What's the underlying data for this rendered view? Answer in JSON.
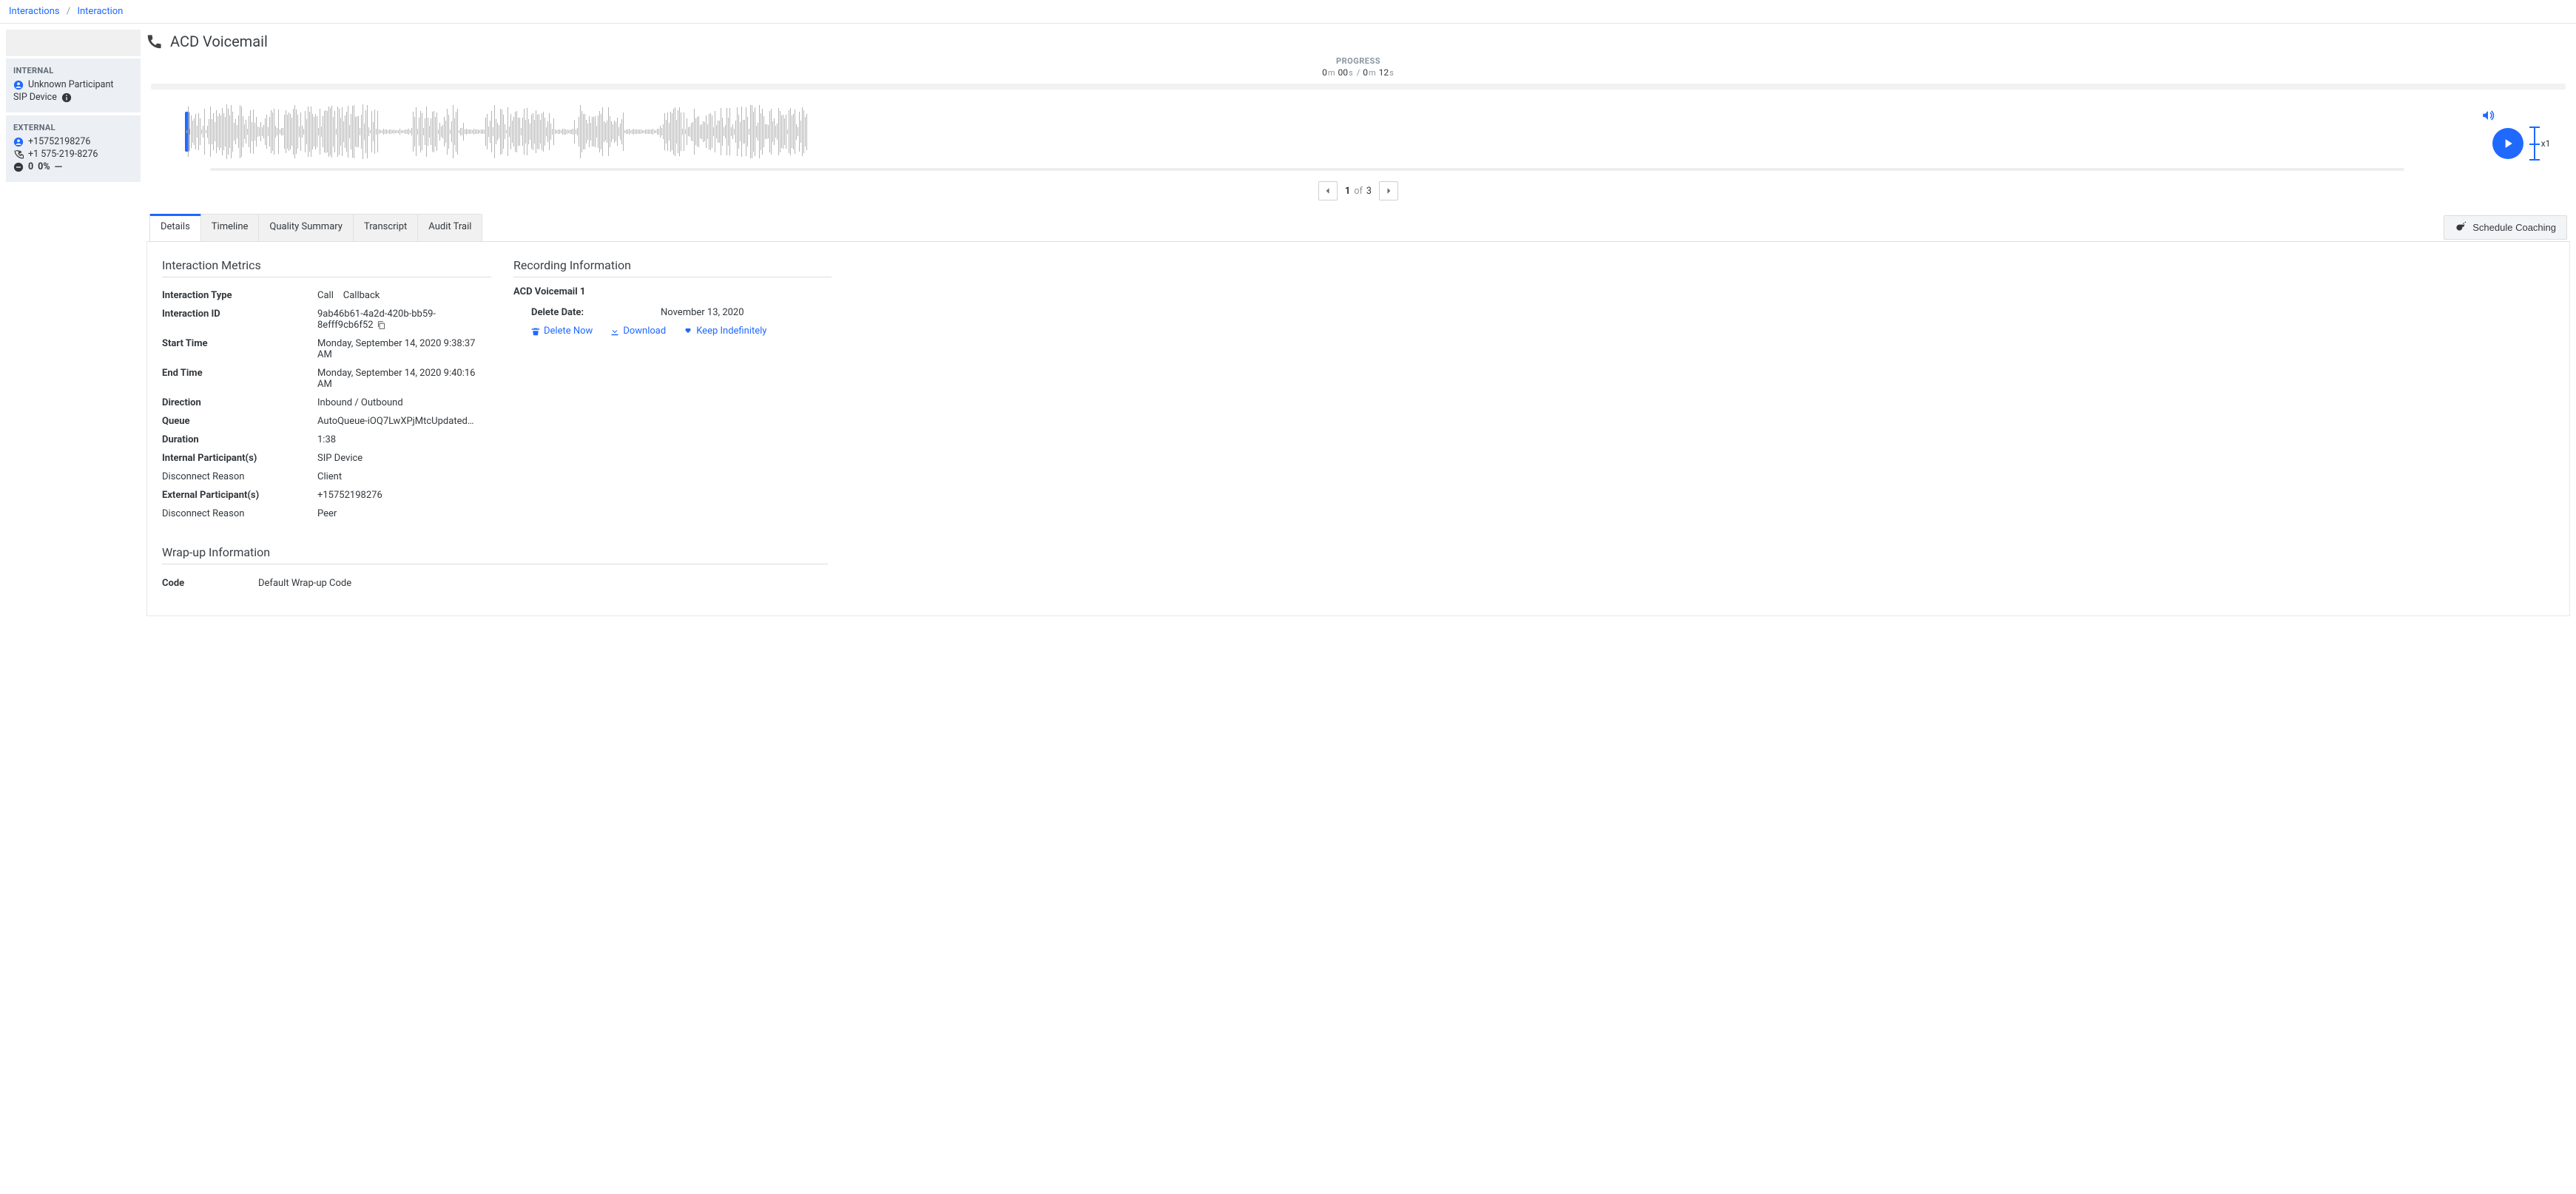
{
  "breadcrumb": {
    "root": "Interactions",
    "current": "Interaction"
  },
  "title": "ACD Voicemail",
  "participants": {
    "internal": {
      "heading": "INTERNAL",
      "name": "Unknown Participant",
      "device": "SIP Device"
    },
    "external": {
      "heading": "EXTERNAL",
      "raw_number": "+15752198276",
      "formatted_number": "+1 575-219-8276",
      "sentiment_count": "0",
      "sentiment_pct": "0%"
    }
  },
  "player": {
    "progress_label": "PROGRESS",
    "current_m": "0",
    "current_s": "00",
    "total_m": "0",
    "total_s": "12",
    "m_unit": "m",
    "s_unit": "s",
    "sep": "/",
    "speed": "x1",
    "pager_current": "1",
    "pager_of": "of",
    "pager_total": "3"
  },
  "tabs": {
    "details": "Details",
    "timeline": "Timeline",
    "quality": "Quality Summary",
    "transcript": "Transcript",
    "audit": "Audit Trail"
  },
  "schedule_btn": "Schedule Coaching",
  "metrics": {
    "heading": "Interaction Metrics",
    "type_label": "Interaction Type",
    "type_value": "Call    Callback",
    "id_label": "Interaction ID",
    "id_value": "9ab46b61-4a2d-420b-bb59-8efff9cb6f52",
    "start_label": "Start Time",
    "start_value": "Monday, September 14, 2020 9:38:37 AM",
    "end_label": "End Time",
    "end_value": "Monday, September 14, 2020 9:40:16 AM",
    "dir_label": "Direction",
    "dir_value": "Inbound / Outbound",
    "queue_label": "Queue",
    "queue_value": "AutoQueue-iOQ7LwXPjMtcUpdated…",
    "dur_label": "Duration",
    "dur_value": "1:38",
    "int_part_label": "Internal Participant(s)",
    "int_part_value": "SIP Device",
    "int_disc_label": "Disconnect Reason",
    "int_disc_value": "Client",
    "ext_part_label": "External Participant(s)",
    "ext_part_value": "+15752198276",
    "ext_disc_label": "Disconnect Reason",
    "ext_disc_value": "Peer"
  },
  "recinfo": {
    "heading": "Recording Information",
    "rec_name": "ACD Voicemail 1",
    "delete_label": "Delete Date:",
    "delete_value": "November 13, 2020",
    "delete_now": "Delete Now",
    "download": "Download",
    "keep": "Keep Indefinitely"
  },
  "wrapup": {
    "heading": "Wrap-up Information",
    "code_label": "Code",
    "code_value": "Default Wrap-up Code"
  }
}
